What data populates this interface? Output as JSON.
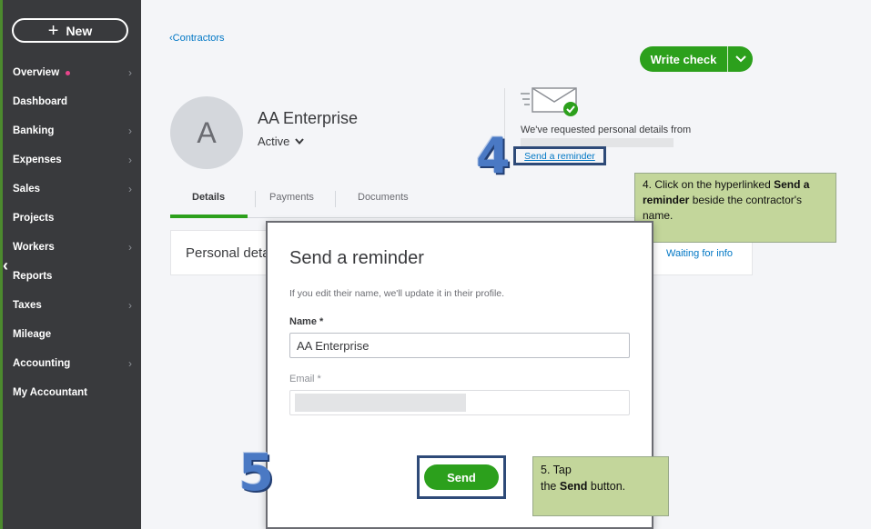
{
  "sidebar": {
    "new_label": "New",
    "items": [
      {
        "label": "Overview",
        "dot": true,
        "chevron": true
      },
      {
        "label": "Dashboard",
        "chevron": false
      },
      {
        "label": "Banking",
        "chevron": true
      },
      {
        "label": "Expenses",
        "chevron": true
      },
      {
        "label": "Sales",
        "chevron": true
      },
      {
        "label": "Projects",
        "chevron": false
      },
      {
        "label": "Workers",
        "chevron": true
      },
      {
        "label": "Reports",
        "chevron": false
      },
      {
        "label": "Taxes",
        "chevron": true
      },
      {
        "label": "Mileage",
        "chevron": false
      },
      {
        "label": "Accounting",
        "chevron": true
      },
      {
        "label": "My Accountant",
        "chevron": false
      }
    ]
  },
  "header": {
    "breadcrumb": "Contractors",
    "write_check_label": "Write check"
  },
  "contractor": {
    "avatar_letter": "A",
    "name": "AA Enterprise",
    "status": "Active"
  },
  "request_panel": {
    "text": "We've requested personal details from",
    "link": "Send a reminder"
  },
  "tabs": [
    "Details",
    "Payments",
    "Documents"
  ],
  "card": {
    "label": "Personal details",
    "status": "Waiting for info"
  },
  "modal": {
    "title": "Send a reminder",
    "help": "If you edit their name, we'll update it in their profile.",
    "name_label": "Name *",
    "name_value": "AA Enterprise",
    "email_label": "Email *",
    "send_label": "Send"
  },
  "annotations": {
    "step4_number": "4",
    "step5_number": "5",
    "callout4": {
      "pre": "4. Click on the hyperlinked ",
      "bold": "Send a reminder",
      "post": " beside the contractor's name."
    },
    "callout5": {
      "pre1": "5. Tap",
      "pre2": "the ",
      "bold": "Send",
      "post": " button."
    }
  },
  "colors": {
    "sidebar": "#393a3d",
    "accent_green": "#2ca01c",
    "link_blue": "#0077c5",
    "callout_bg": "#c3d69b",
    "highlight_frame": "#2e4a78"
  }
}
